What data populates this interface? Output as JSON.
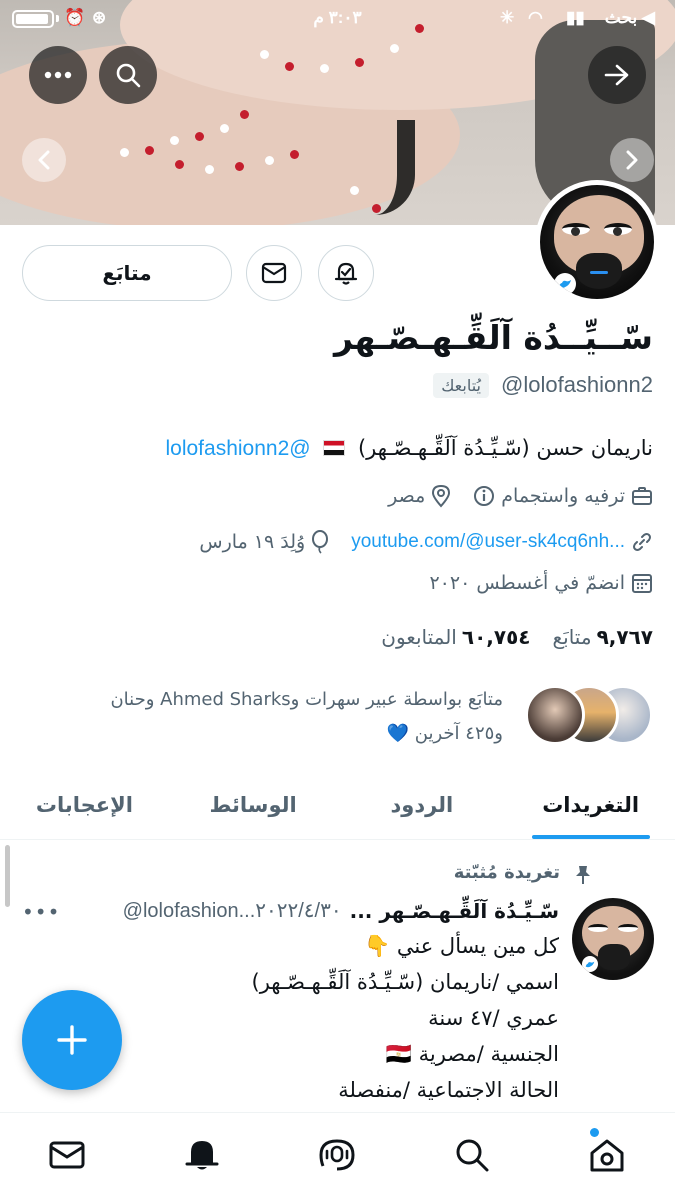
{
  "status_bar": {
    "time": "٣:٠٣ م",
    "back_app": "بحث ◀"
  },
  "profile": {
    "display_name": "سّــيِّــدُة آلَقِّـهـصّـهر",
    "handle": "@lolofashionn2",
    "follows_you": "يُتابعك",
    "follow_button_label": "متابَع",
    "bio_text": "ناريمان حسن (سّـيِّـدُة آلَقِّـهـصّـهر)",
    "bio_mention": "@lolofashionn2",
    "category": "ترفيه واستجمام",
    "location": "مصر",
    "website": "youtube.com/@user-sk4cq6nh...",
    "birthday": "وُلِدَ ١٩ مارس",
    "joined": "انضمّ في أغسطس ٢٠٢٠",
    "following_count": "٩,٧٦٧",
    "following_label": "متابَع",
    "followers_count": "٦٠,٧٥٤",
    "followers_label": "المتابعون",
    "followers_you_know_line1": "متابَع بواسطة عبير سهرات وAhmed Sharks وحنان",
    "followers_you_know_line2": "و٤٢٥ آخرين 💙"
  },
  "tabs": [
    {
      "label": "التغريدات",
      "active": true
    },
    {
      "label": "الردود",
      "active": false
    },
    {
      "label": "الوسائط",
      "active": false
    },
    {
      "label": "الإعجابات",
      "active": false
    }
  ],
  "pinned_tweet": {
    "pinned_label": "تغريدة مُثبّتة",
    "author_name": "سّـيِّـدُة آلَقِّـهـصّـهر ...",
    "author_handle_and_date": "@lolofashion...٢٠٢٢/٤/٣٠",
    "more_label": "•••",
    "lines": [
      "كل مين يسأل عني 👇",
      "اسمي /ناريمان (سّـيِّـدُة آلَقِّـهـصّـهر)",
      "عمري /٤٧ سنة",
      "الجنسية /مصرية 🇪🇬",
      "الحالة الاجتماعية /منفصلة"
    ]
  },
  "icons": {
    "more": "more-icon",
    "search": "search-icon",
    "forward": "arrow-right-icon",
    "mail": "mail-icon",
    "notify": "bell-plus-icon",
    "compose": "plus-icon"
  },
  "colors": {
    "accent": "#1d9bf0",
    "text": "#0f1419",
    "secondary": "#536471"
  }
}
